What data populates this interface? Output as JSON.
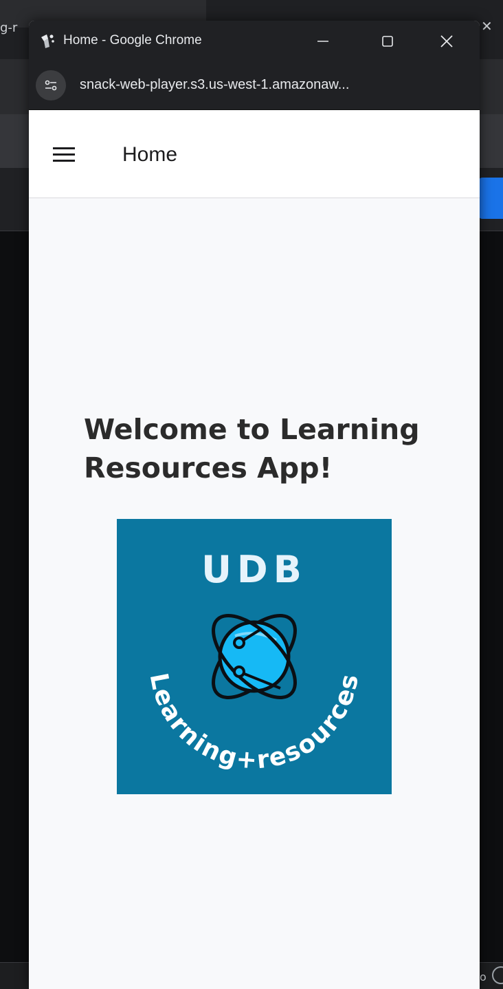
{
  "background": {
    "tab_fragment": "g-r",
    "bottom_fragment": "o"
  },
  "window": {
    "title": "Home - Google Chrome",
    "url": "snack-web-player.s3.us-west-1.amazonaw..."
  },
  "app": {
    "header_title": "Home",
    "welcome_text": "Welcome to Learning Resources App!",
    "logo": {
      "top_text": "UDB",
      "arc_text": "Learning+resources",
      "bg_color": "#0b77a0",
      "planet_color": "#16b9f5"
    }
  }
}
